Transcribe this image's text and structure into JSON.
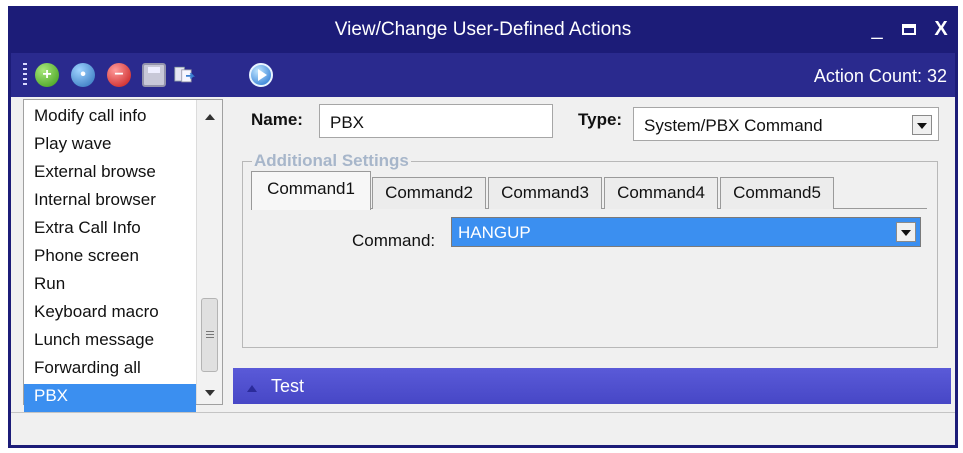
{
  "window": {
    "title": "View/Change User-Defined Actions",
    "controls": {
      "minimize": "_",
      "close": "X"
    }
  },
  "toolbar": {
    "action_count": "Action Count: 32",
    "icons": [
      "add-icon",
      "copy-icon",
      "delete-icon",
      "save-icon",
      "export-icon",
      "run-icon"
    ]
  },
  "actions_list": {
    "items": [
      "Modify call info",
      "Play wave",
      "External browse",
      "Internal browser",
      "Extra Call Info",
      "Phone screen",
      "Run",
      "Keyboard macro",
      "Lunch message",
      "Forwarding all",
      "PBX"
    ],
    "selected": "PBX"
  },
  "form": {
    "name_label": "Name:",
    "name_value": "PBX",
    "type_label": "Type:",
    "type_value": "System/PBX Command"
  },
  "additional_settings": {
    "legend": "Additional Settings",
    "tabs": [
      "Command1",
      "Command2",
      "Command3",
      "Command4",
      "Command5"
    ],
    "active_tab": "Command1",
    "command_label": "Command:",
    "command_value": "HANGUP"
  },
  "test_panel": {
    "label": "Test"
  },
  "colors": {
    "title_bar": "#1c1c78",
    "toolbar": "#2a2a8e",
    "selection": "#3b8ff0",
    "test_bar": "#4f4fcf"
  }
}
